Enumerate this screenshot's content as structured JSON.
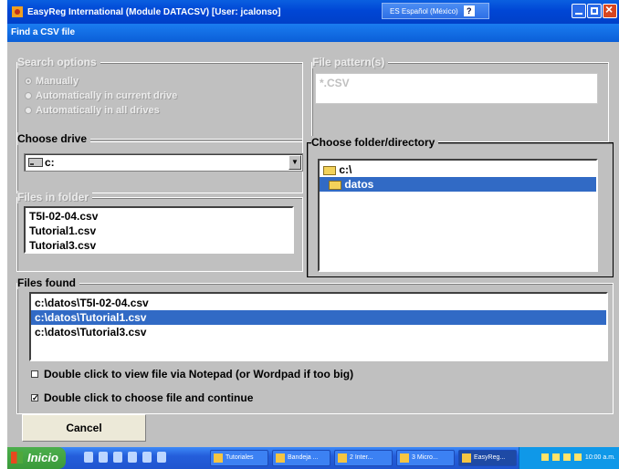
{
  "window": {
    "title": "EasyReg International (Module DATACSV) [User: jcalonso]",
    "language_bar": "ES Español (México)",
    "help_label": "?",
    "controls": [
      "minimize",
      "maximize",
      "close"
    ]
  },
  "dialog": {
    "title": "Find a CSV file",
    "search_options": {
      "legend": "Search options",
      "options": [
        {
          "label": "Manually",
          "selected": true
        },
        {
          "label": "Automatically in current drive",
          "selected": false
        },
        {
          "label": "Automatically in all drives",
          "selected": false
        }
      ]
    },
    "file_pattern": {
      "legend": "File pattern(s)",
      "value": "*.CSV"
    },
    "choose_drive": {
      "legend": "Choose drive",
      "value": "c:"
    },
    "files_in_folder": {
      "legend": "Files in folder",
      "items": [
        "T5I-02-04.csv",
        "Tutorial1.csv",
        "Tutorial3.csv"
      ]
    },
    "choose_folder": {
      "legend": "Choose folder/directory",
      "items": [
        {
          "label": "c:\\",
          "selected": false
        },
        {
          "label": "datos",
          "selected": true
        }
      ]
    },
    "files_found": {
      "legend": "Files found",
      "items": [
        {
          "label": "c:\\datos\\T5I-02-04.csv",
          "selected": false
        },
        {
          "label": "c:\\datos\\Tutorial1.csv",
          "selected": true
        },
        {
          "label": "c:\\datos\\Tutorial3.csv",
          "selected": false
        }
      ]
    },
    "options": [
      {
        "label": "Double click to view file via Notepad (or Wordpad if too big)",
        "checked": false
      },
      {
        "label": "Double click to choose file and continue",
        "checked": true
      }
    ],
    "cancel_label": "Cancel",
    "check_mark": "✓"
  },
  "taskbar": {
    "start_label": "Inicio",
    "buttons": [
      "Tutoriales",
      "Bandeja ...",
      "2 Inter...",
      "3 Micro...",
      "EasyReg..."
    ],
    "clock": "10:00 a.m."
  }
}
